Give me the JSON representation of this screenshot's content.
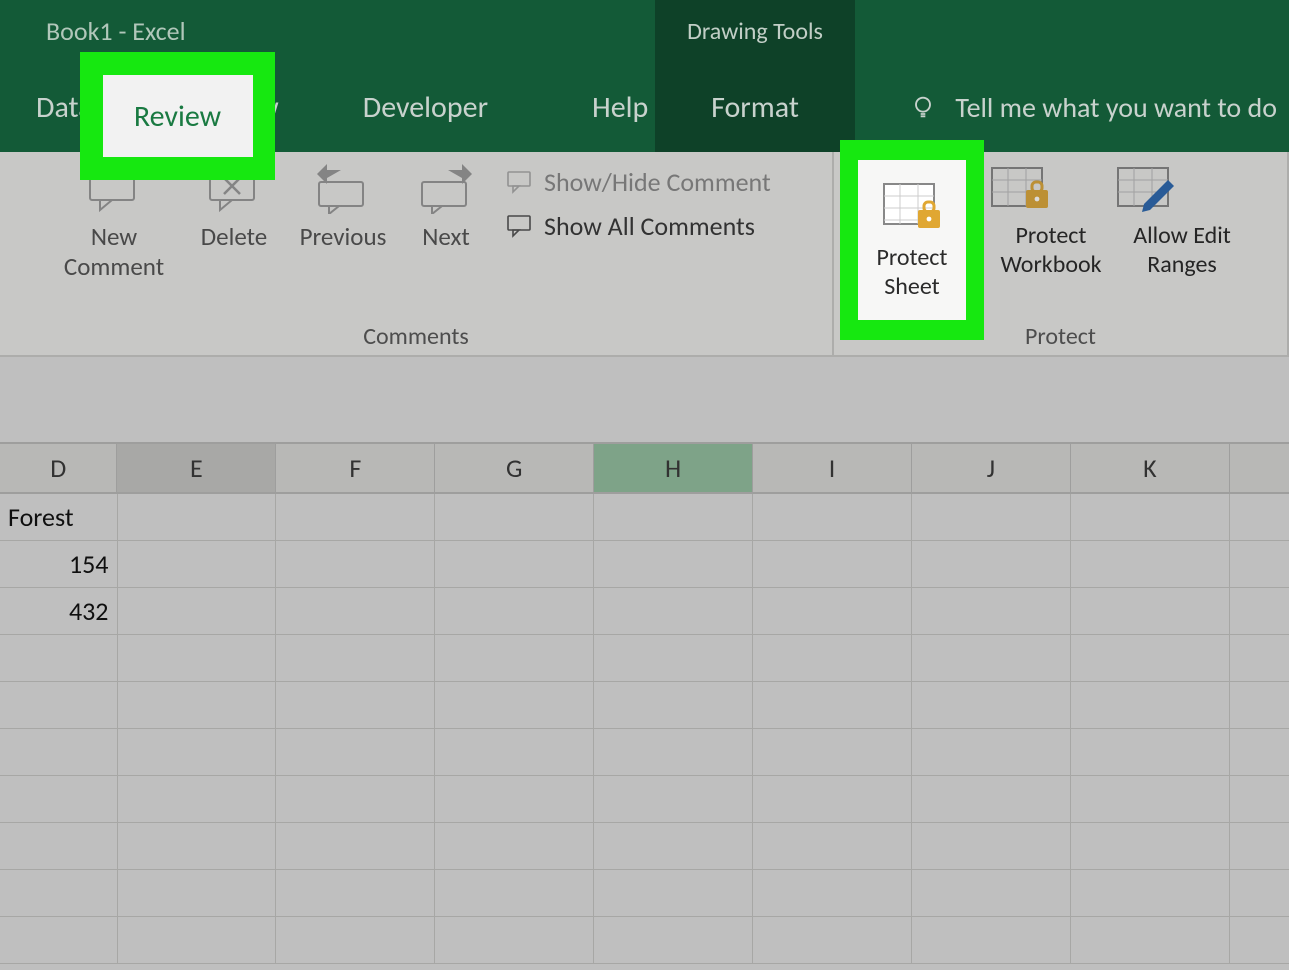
{
  "titlebar": {
    "title": "Book1  -  Excel",
    "context_tools": "Drawing Tools"
  },
  "tabs": {
    "data": "Data",
    "review": "Review",
    "view": "View",
    "developer": "Developer",
    "help": "Help",
    "format": "Format"
  },
  "tellme": {
    "placeholder": "Tell me what you want to do"
  },
  "ribbon": {
    "comments": {
      "new_comment": "New Comment",
      "delete": "Delete",
      "previous": "Previous",
      "next": "Next",
      "show_hide": "Show/Hide Comment",
      "show_all": "Show All Comments",
      "group_label": "Comments"
    },
    "protect": {
      "protect_sheet": "Protect Sheet",
      "protect_workbook": "Protect Workbook",
      "allow_edit_ranges": "Allow Edit Ranges",
      "group_label": "Protect"
    }
  },
  "columns": [
    "D",
    "E",
    "F",
    "G",
    "H",
    "I",
    "J",
    "K"
  ],
  "cells": {
    "d1": "Forest",
    "d2": "154",
    "d3": "432"
  }
}
